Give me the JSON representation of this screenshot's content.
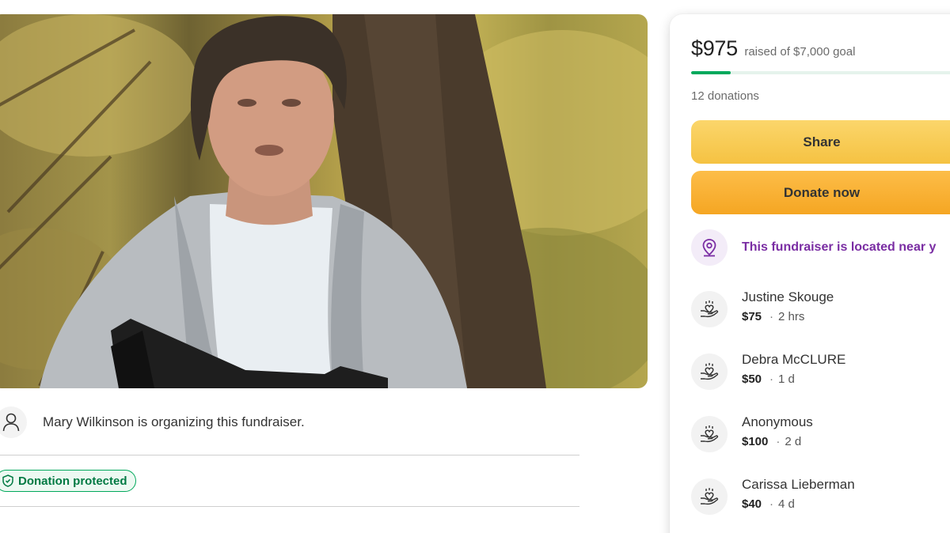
{
  "photo": {
    "subject": "fundraiser-photo"
  },
  "organizer": {
    "text": "Mary Wilkinson is organizing this fundraiser."
  },
  "protection": {
    "label": "Donation protected",
    "color": "#02a95c"
  },
  "campaign": {
    "raised_amount": "$975",
    "goal_text": "raised of $7,000 goal",
    "progress_fraction": 0.139,
    "donation_count": "12 donations",
    "accent_color": "#02a95c"
  },
  "actions": {
    "share_label": "Share",
    "donate_label": "Donate now"
  },
  "location": {
    "text": "This fundraiser is located near y",
    "icon": "location-pin-icon"
  },
  "donations": [
    {
      "name": "Justine Skouge",
      "amount": "$75",
      "sep": "·",
      "time": "2 hrs"
    },
    {
      "name": "Debra McCLURE",
      "amount": "$50",
      "sep": "·",
      "time": "1 d"
    },
    {
      "name": "Anonymous",
      "amount": "$100",
      "sep": "·",
      "time": "2 d"
    },
    {
      "name": "Carissa Lieberman",
      "amount": "$40",
      "sep": "·",
      "time": "4 d"
    }
  ]
}
